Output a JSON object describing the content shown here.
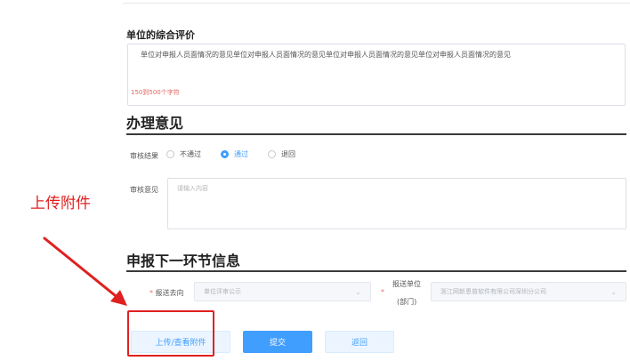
{
  "evaluation": {
    "title": "单位的综合评价",
    "value": "单位对申报人员面情况的意见单位对申报人员面情况的意见单位对申报人员面情况的意见单位对申报人员面情况的意见",
    "char_hint": "150到500个字符"
  },
  "handling": {
    "title": "办理意见",
    "result_label": "审核结果",
    "options": [
      {
        "label": "不通过",
        "checked": false
      },
      {
        "label": "通过",
        "checked": true
      },
      {
        "label": "退回",
        "checked": false
      }
    ],
    "opinion_label": "审核意见",
    "opinion_placeholder": "请输入内容"
  },
  "next_step": {
    "title": "申报下一环节信息",
    "dest_label": "报送去向",
    "dest_value": "单位评审公示",
    "unit_label_line1": "报送单位",
    "unit_label_line2": "(部门)",
    "unit_value": "浙江网新恩普软件有限公司深圳分公司"
  },
  "buttons": {
    "upload": "上传/查看附件",
    "submit": "提交",
    "return": "返回"
  },
  "annotation": {
    "text": "上传附件",
    "color": "#e02020"
  },
  "colors": {
    "primary": "#409eff",
    "danger": "#f56c6c"
  }
}
